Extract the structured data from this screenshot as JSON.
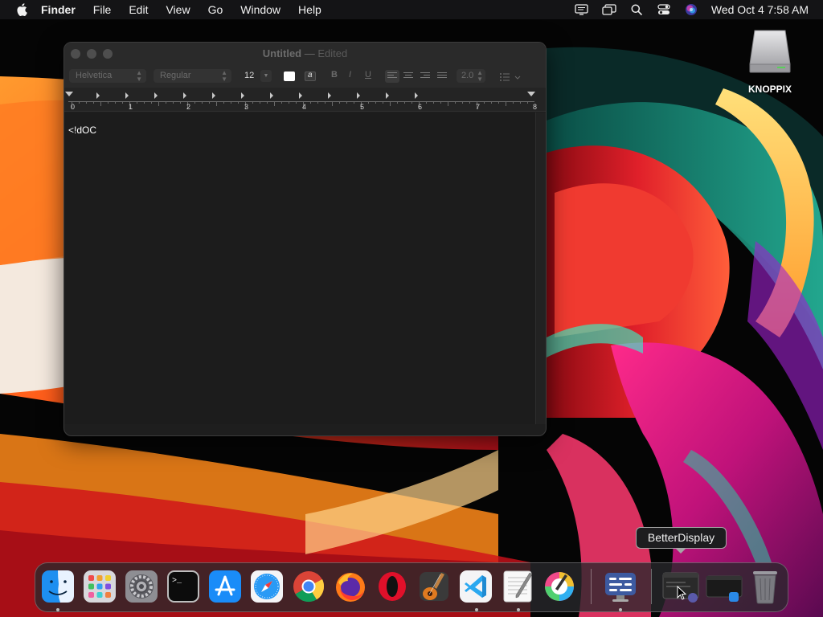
{
  "menubar": {
    "app_name": "Finder",
    "items": [
      "File",
      "Edit",
      "View",
      "Go",
      "Window",
      "Help"
    ],
    "clock": "Wed Oct 4  7:58 AM",
    "status_icons": [
      "display-icon",
      "screen-mirroring-icon",
      "search-icon",
      "control-center-icon",
      "siri-icon"
    ]
  },
  "desktop": {
    "drive_label": "KNOPPIX"
  },
  "window": {
    "title": "Untitled",
    "separator": "—",
    "status": "Edited",
    "toolbar": {
      "font_family": "Helvetica",
      "font_style": "Regular",
      "font_size": "12",
      "bold": "B",
      "italic": "I",
      "underline": "U",
      "line_spacing": "2.0",
      "text_color": "#ffffff"
    },
    "ruler_numbers": [
      "0",
      "1",
      "2",
      "3",
      "4",
      "5",
      "6",
      "7",
      "8"
    ],
    "document_text": "<!dOC"
  },
  "tooltip": {
    "text": "BetterDisplay"
  },
  "dock": {
    "apps": [
      "Finder",
      "Launchpad",
      "System Settings",
      "Terminal",
      "App Store",
      "Safari",
      "Google Chrome",
      "Firefox",
      "Opera",
      "GarageBand",
      "Visual Studio Code",
      "TextEdit",
      "Color Picker",
      "BetterDisplay"
    ],
    "trash_label": "Trash"
  }
}
